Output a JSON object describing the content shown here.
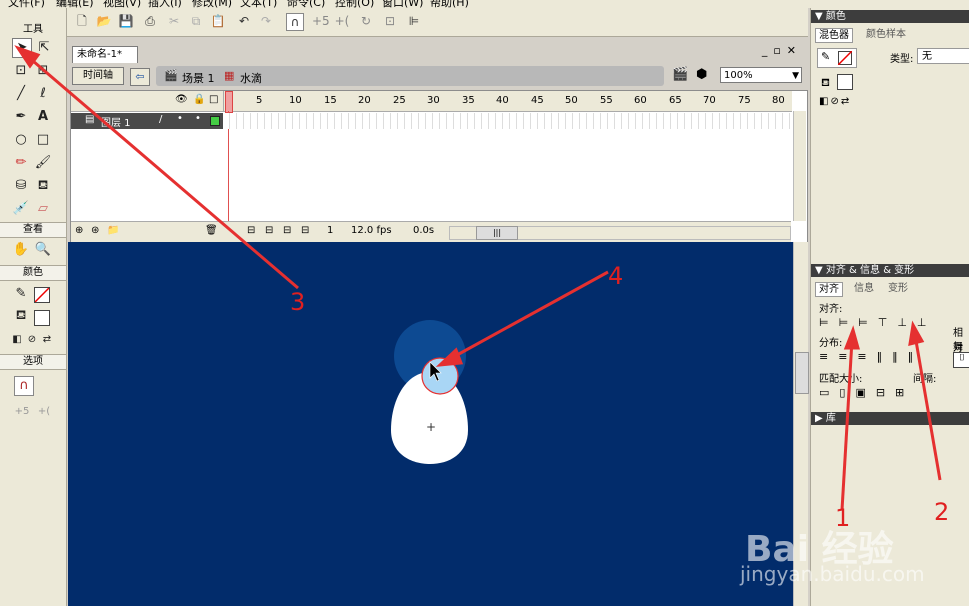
{
  "menu": [
    "文件(F)",
    "编辑(E)",
    "视图(V)",
    "插入(I)",
    "修改(M)",
    "文本(T)",
    "命令(C)",
    "控制(O)",
    "窗口(W)",
    "帮助(H)"
  ],
  "tools_panel": {
    "title": "工具",
    "view_label": "查看",
    "color_label": "颜色",
    "options_label": "选项"
  },
  "document": {
    "tab_title": "未命名-1*",
    "timeline_button": "时间轴",
    "scene_label": "场景 1",
    "symbol_label": "水滴",
    "zoom": "100%"
  },
  "timeline": {
    "layer_name": "图层 1",
    "frame_numbers": [
      "1",
      "5",
      "10",
      "15",
      "20",
      "25",
      "30",
      "35",
      "40",
      "45",
      "50",
      "55",
      "60",
      "65",
      "70",
      "75",
      "80"
    ],
    "current_frame": "1",
    "fps": "12.0 fps",
    "time": "0.0s"
  },
  "color_panel": {
    "title": "颜色",
    "tab_mixer": "混色器",
    "tab_swatches": "颜色样本",
    "type_label": "类型:",
    "type_value": "无"
  },
  "align_panel": {
    "title": "对齐 & 信息 & 变形",
    "tab_align": "对齐",
    "tab_info": "信息",
    "tab_transform": "变形",
    "align_label": "对齐:",
    "distribute_label": "分布:",
    "match_size_label": "匹配大小:",
    "spacing_label": "间隔:",
    "relative_label": "相对",
    "stage_label": "舞台"
  },
  "library_panel": {
    "title": "库"
  },
  "annotations": [
    "1",
    "2",
    "3",
    "4"
  ],
  "watermark": {
    "main": "Bai 经验",
    "sub": "jingyan.baidu.com"
  },
  "colors": {
    "stage": "#022c6b",
    "arrow": "#e53030",
    "playhead": "#e05050"
  }
}
